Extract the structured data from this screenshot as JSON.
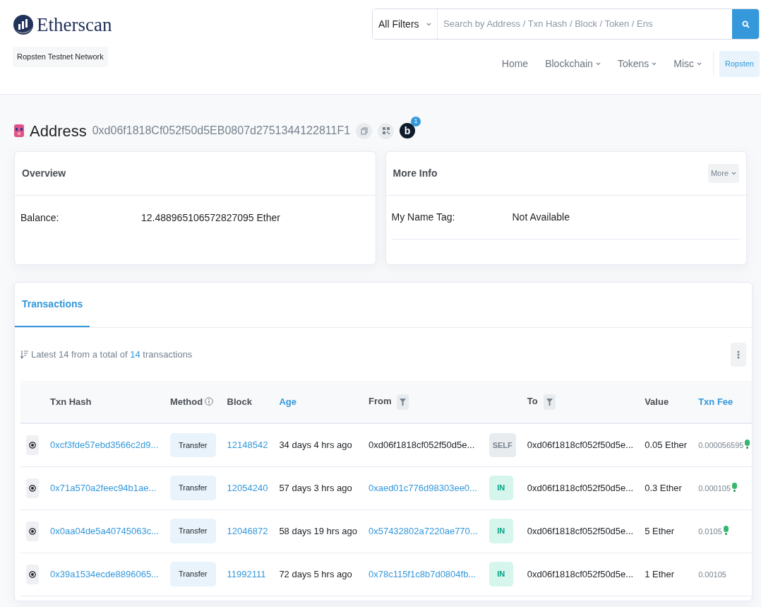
{
  "brand": {
    "name": "Etherscan",
    "network": "Ropsten Testnet Network"
  },
  "search": {
    "filter": "All Filters",
    "placeholder": "Search by Address / Txn Hash / Block / Token / Ens"
  },
  "nav": [
    {
      "label": "Home",
      "dropdown": false
    },
    {
      "label": "Blockchain",
      "dropdown": true
    },
    {
      "label": "Tokens",
      "dropdown": true
    },
    {
      "label": "Misc",
      "dropdown": true
    }
  ],
  "network_button": "Ropsten",
  "address": {
    "label": "Address",
    "value": "0xd06f1818Cf052f50d5EB0807d2751344122811F1",
    "blockscan_label": "b",
    "notification_count": "1"
  },
  "overview": {
    "title": "Overview",
    "fields": [
      {
        "label": "Balance:",
        "value": "12.488965106572827095 Ether"
      }
    ]
  },
  "more_info": {
    "title": "More Info",
    "more_button": "More",
    "fields": [
      {
        "label": "My Name Tag:",
        "value": "Not Available"
      }
    ]
  },
  "tabs": [
    {
      "label": "Transactions",
      "selected": true
    }
  ],
  "summary": {
    "before": "Latest 14 from a total of ",
    "count": "14",
    "after": " transactions"
  },
  "table": {
    "columns": [
      {
        "label": "Txn Hash",
        "highlighted": false,
        "info": false,
        "filter": false
      },
      {
        "label": "Method",
        "highlighted": false,
        "info": true,
        "filter": false
      },
      {
        "label": "Block",
        "highlighted": false,
        "info": false,
        "filter": false
      },
      {
        "label": "Age",
        "highlighted": true,
        "info": false,
        "filter": false
      },
      {
        "label": "From",
        "highlighted": false,
        "info": false,
        "filter": true
      },
      {
        "label": "To",
        "highlighted": false,
        "info": false,
        "filter": true
      },
      {
        "label": "Value",
        "highlighted": false,
        "info": false,
        "filter": false
      },
      {
        "label": "Txn Fee",
        "highlighted": true,
        "info": false,
        "filter": false
      }
    ],
    "rows": [
      {
        "hash": "0xcf3fde57ebd3566c2d9...",
        "method": "Transfer",
        "block": "12148542",
        "age": "34 days 4 hrs ago",
        "from": "0xd06f1818cf052f50d5e...",
        "from_link": false,
        "direction": {
          "kind": "self",
          "label": "SELF"
        },
        "to": "0xd06f1818cf052f50d5e...",
        "value": "0.05 Ether",
        "fee": "0.000056595",
        "fee_icon": true
      },
      {
        "hash": "0x71a570a2feec94b1ae...",
        "method": "Transfer",
        "block": "12054240",
        "age": "57 days 3 hrs ago",
        "from": "0xaed01c776d98303ee0...",
        "from_link": true,
        "direction": {
          "kind": "in",
          "label": "IN"
        },
        "to": "0xd06f1818cf052f50d5e...",
        "value": "0.3 Ether",
        "fee": "0.000105",
        "fee_icon": true
      },
      {
        "hash": "0x0aa04de5a40745063c...",
        "method": "Transfer",
        "block": "12046872",
        "age": "58 days 19 hrs ago",
        "from": "0x57432802a7220ae770...",
        "from_link": true,
        "direction": {
          "kind": "in",
          "label": "IN"
        },
        "to": "0xd06f1818cf052f50d5e...",
        "value": "5 Ether",
        "fee": "0.0105",
        "fee_icon": true
      },
      {
        "hash": "0x39a1534ecde8896065...",
        "method": "Transfer",
        "block": "11992111",
        "age": "72 days 5 hrs ago",
        "from": "0x78c115f1c8b7d0804fb...",
        "from_link": true,
        "direction": {
          "kind": "in",
          "label": "IN"
        },
        "to": "0xd06f1818cf052f50d5e...",
        "value": "1 Ether",
        "fee": "0.00105",
        "fee_icon": false
      }
    ]
  }
}
